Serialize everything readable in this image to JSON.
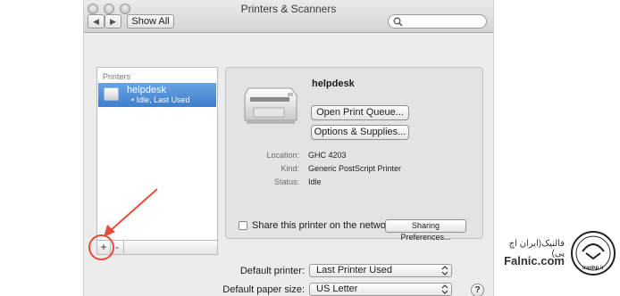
{
  "window": {
    "title": "Printers & Scanners",
    "toolbar": {
      "back_label": "◀",
      "forward_label": "▶",
      "show_all_label": "Show All",
      "search_placeholder": ""
    }
  },
  "printers": {
    "header": "Printers",
    "items": [
      {
        "name": "helpdesk",
        "status": "• Idle, Last Used"
      }
    ],
    "add_label": "+",
    "remove_label": "-"
  },
  "details": {
    "name": "helpdesk",
    "open_queue_label": "Open Print Queue...",
    "options_label": "Options & Supplies...",
    "location_label": "Location:",
    "location_value": "GHC 4203",
    "kind_label": "Kind:",
    "kind_value": "Generic PostScript Printer",
    "status_label": "Status:",
    "status_value": "Idle",
    "share_label": "Share this printer on the network",
    "share_checked": false,
    "sharing_prefs_label": "Sharing Preferences..."
  },
  "defaults": {
    "printer_label": "Default printer:",
    "printer_value": "Last Printer Used",
    "paper_label": "Default paper size:",
    "paper_value": "US Letter",
    "help_label": "?"
  },
  "watermark": {
    "persian_text": "فالنیک(ایران اچ پی)",
    "english_text": "Falnic.com",
    "seal_text": "iranhp.ir"
  },
  "colors": {
    "selection": "#3d7fcf",
    "annotation": "#e74c3c"
  }
}
